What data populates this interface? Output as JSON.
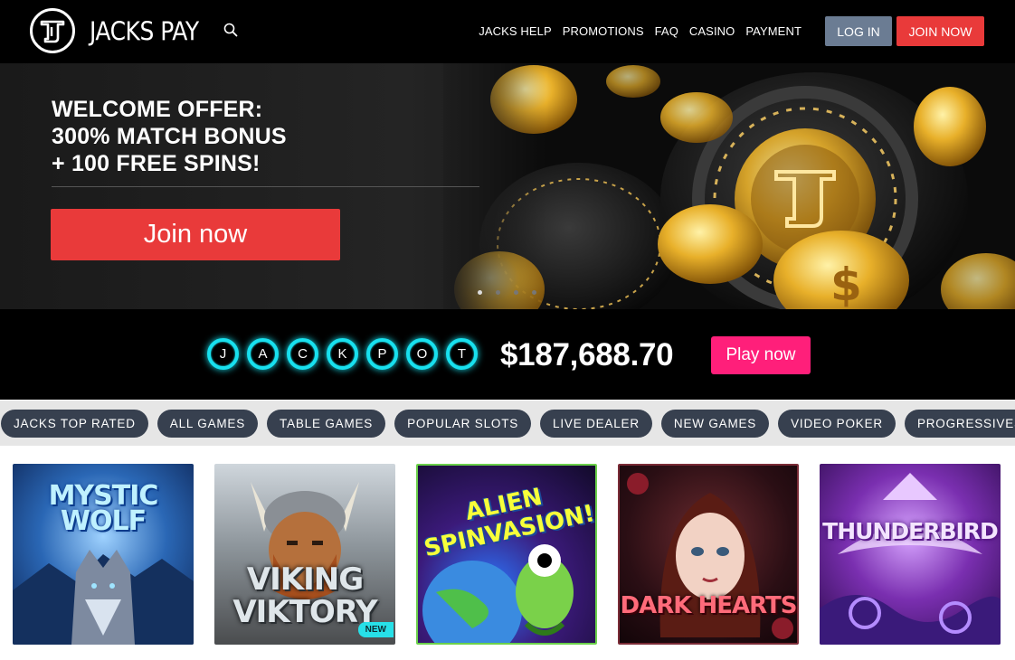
{
  "brand": {
    "name": "JACKS PAY"
  },
  "nav": {
    "items": [
      "JACKS HELP",
      "PROMOTIONS",
      "FAQ",
      "CASINO",
      "PAYMENT"
    ],
    "login": "LOG IN",
    "join": "JOIN NOW"
  },
  "hero": {
    "title_lines": [
      "WELCOME OFFER:",
      "300% MATCH BONUS",
      "+ 100 FREE SPINS!"
    ],
    "cta": "Join now",
    "slides": 4,
    "active_slide": 1
  },
  "jackpot": {
    "letters": [
      "J",
      "A",
      "C",
      "K",
      "P",
      "O",
      "T"
    ],
    "amount": "$187,688.70",
    "play": "Play now"
  },
  "categories": [
    "JACKS TOP RATED",
    "ALL GAMES",
    "TABLE GAMES",
    "POPULAR SLOTS",
    "LIVE DEALER",
    "NEW GAMES",
    "VIDEO POKER",
    "PROGRESSIVES"
  ],
  "games": [
    {
      "title": "MYSTIC WOLF",
      "badge": ""
    },
    {
      "title": "VIKING VIKTORY",
      "badge": "NEW"
    },
    {
      "title": "ALIEN SPINVASION!",
      "badge": ""
    },
    {
      "title": "DARK HEARTS",
      "badge": ""
    },
    {
      "title": "THUNDERBIRD",
      "badge": ""
    }
  ],
  "colors": {
    "header_bg": "#000000",
    "login_bg": "#6b7c93",
    "join_bg": "#e93a3a",
    "jackpot_ring": "#18e0ee",
    "play_bg": "#ff1f7a",
    "category_pill": "#37404f",
    "new_badge": "#27e0e8"
  },
  "icons": {
    "search": "search-icon",
    "logo": "top-hat-logo-icon"
  }
}
